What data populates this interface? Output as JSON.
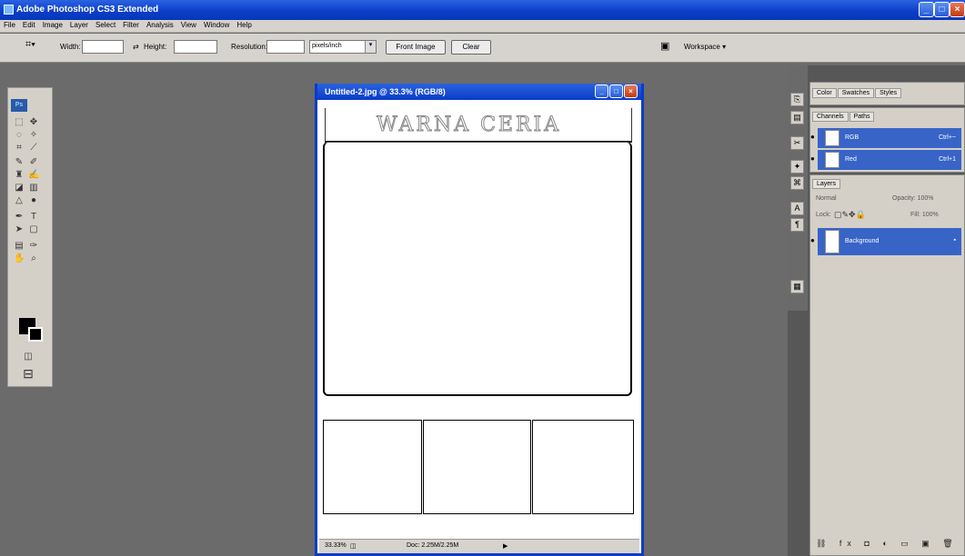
{
  "window": {
    "title": "Adobe Photoshop CS3 Extended"
  },
  "menu": [
    "File",
    "Edit",
    "Image",
    "Layer",
    "Select",
    "Filter",
    "Analysis",
    "View",
    "Window",
    "Help"
  ],
  "options": {
    "width_label": "Width:",
    "height_label": "Height:",
    "resolution_label": "Resolution:",
    "res_unit": "pixels/inch",
    "front_image": "Front Image",
    "clear": "Clear",
    "workspace": "Workspace ▾"
  },
  "toolbox": {
    "logo": "Ps"
  },
  "document": {
    "title": "Untitled-2.jpg @ 33.3% (RGB/8)",
    "header_text": "WARNA  CERIA",
    "zoom": "33.33%",
    "doc_size": "Doc: 2.25M/2.25M"
  },
  "panels": {
    "top_tabs": [
      "Color",
      "Swatches",
      "Styles"
    ],
    "mid_tabs": [
      "Channels",
      "Paths"
    ],
    "channels": [
      {
        "name": "RGB",
        "shortcut": "Ctrl+~"
      },
      {
        "name": "Red",
        "shortcut": "Ctrl+1"
      }
    ],
    "layers_tabs": [
      "Layers"
    ],
    "normal": "Normal",
    "opacity": "Opacity: 100%",
    "lock": "Lock:",
    "fill": "Fill: 100%",
    "layer_name": "Background"
  }
}
